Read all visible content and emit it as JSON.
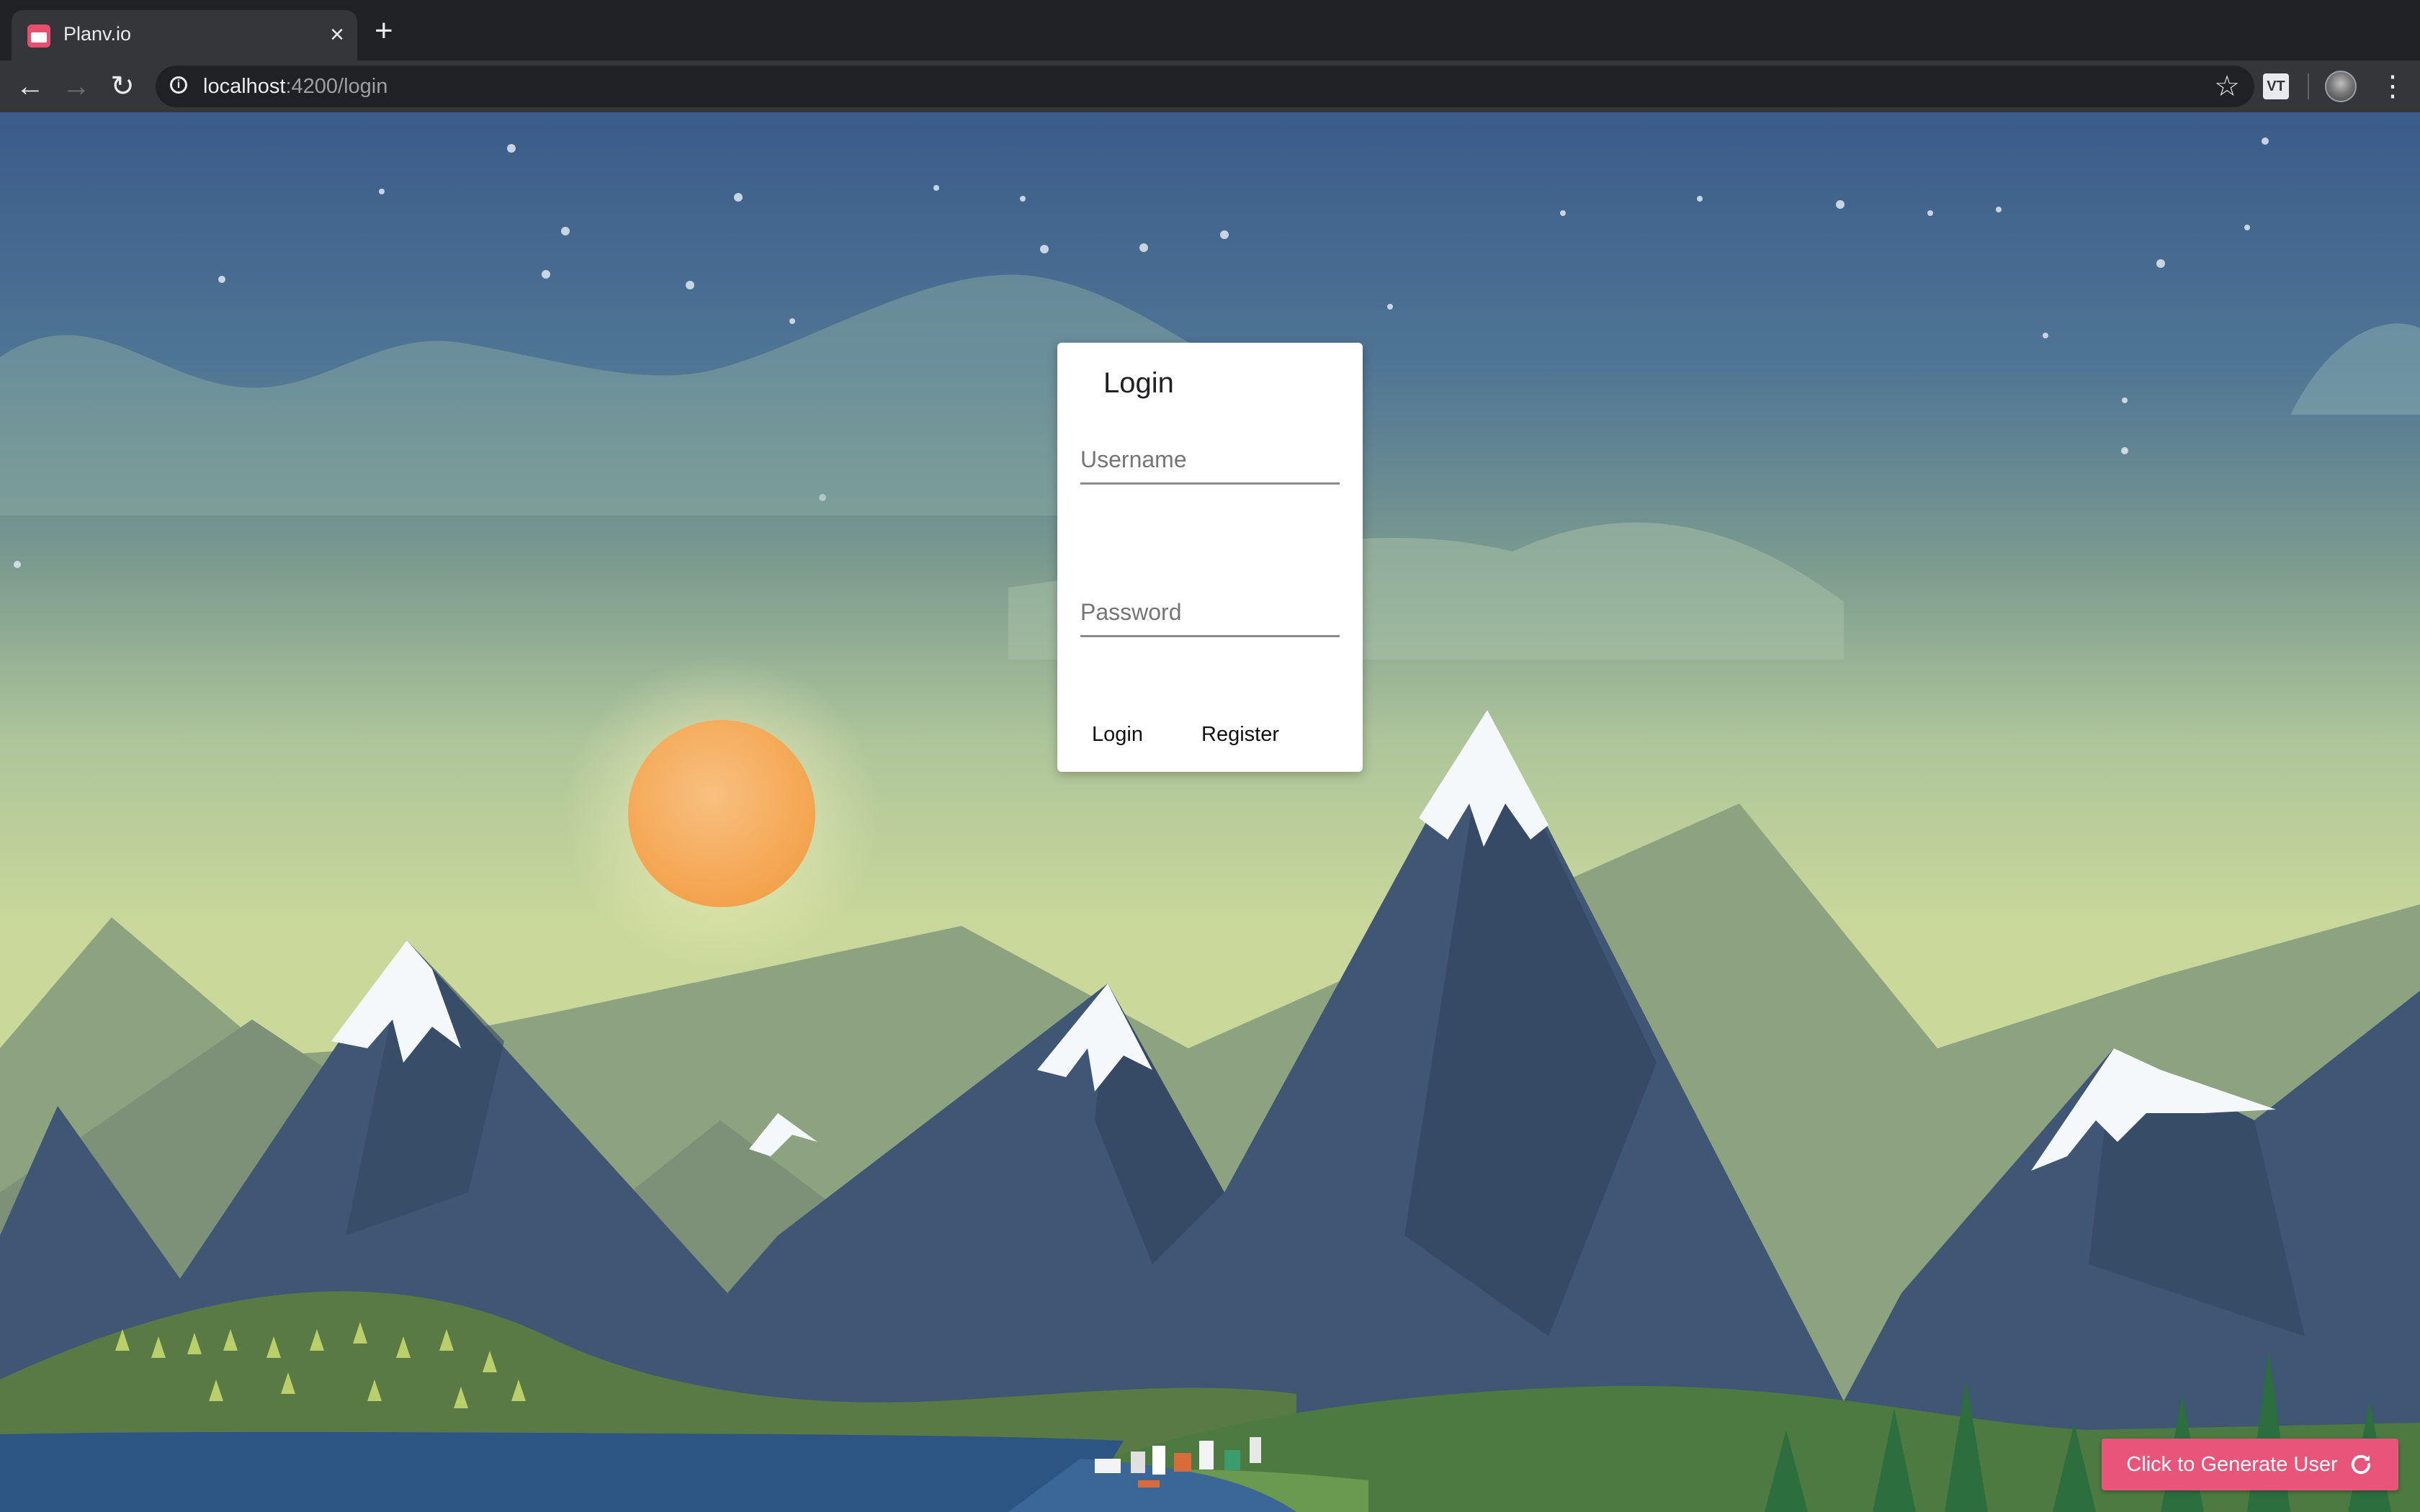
{
  "browser": {
    "tab_title": "Planv.io",
    "close_glyph": "×",
    "new_tab_glyph": "+",
    "url_host": "localhost",
    "url_path": ":4200/login",
    "back_glyph": "←",
    "forward_glyph": "→",
    "reload_glyph": "↻",
    "star_glyph": "☆",
    "menu_glyph": "⋮",
    "extension_label": "VT"
  },
  "login": {
    "title": "Login",
    "username_placeholder": "Username",
    "password_placeholder": "Password",
    "login_button": "Login",
    "register_button": "Register"
  },
  "generate_user": {
    "label": "Click to Generate User"
  },
  "colors": {
    "accent": "#e8547a",
    "sky_top": "#3b5c8a",
    "sun": "#f5a54f"
  },
  "icons": [
    "tab-favicon-icon",
    "close-icon",
    "plus-icon",
    "back-arrow-icon",
    "forward-arrow-icon",
    "reload-icon",
    "info-icon",
    "star-icon",
    "extension-icon",
    "avatar",
    "kebab-menu-icon",
    "refresh-icon"
  ]
}
